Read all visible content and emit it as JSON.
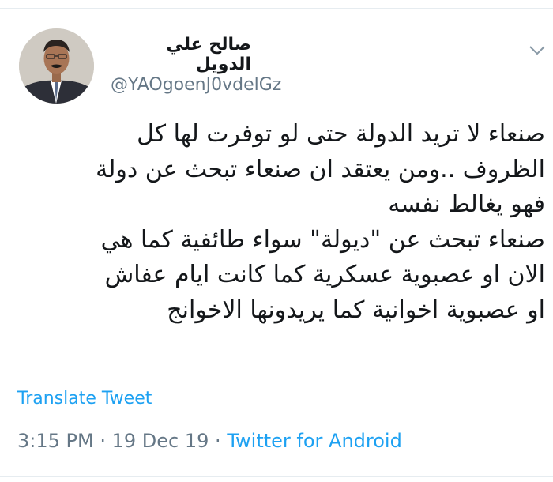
{
  "tweet": {
    "author": {
      "display_name": "صالح علي الدويل",
      "handle": "@YAOgoenJ0vdelGz"
    },
    "lines": [
      "صنعاء لا تريد الدولة حتى لو توفرت لها كل",
      "الظروف ..ومن يعتقد ان صنعاء تبحث عن دولة",
      "فهو يغالط نفسه",
      "صنعاء تبحث عن \"ديولة\" سواء طائفية كما هي",
      "الان او عصبوية عسكرية كما كانت ايام عفاش",
      "او عصبوية اخوانية كما يريدونها الاخوانج"
    ],
    "translate_label": "Translate Tweet",
    "time": "3:15 PM",
    "date": "19 Dec 19",
    "source": "Twitter for Android",
    "separator": "·"
  },
  "icons": {
    "avatar": "avatar-photo",
    "menu": "chevron-down-icon"
  },
  "colors": {
    "link": "#1da1f2",
    "secondary_text": "#657786",
    "primary_text": "#14171a"
  }
}
